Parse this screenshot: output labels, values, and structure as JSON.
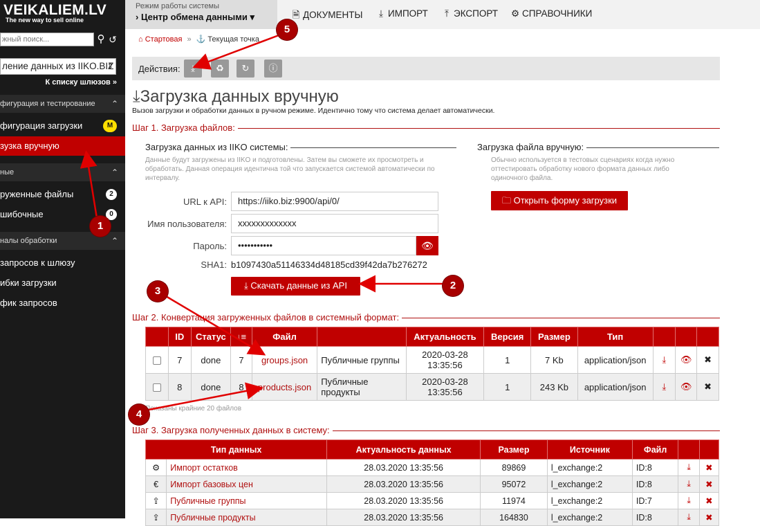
{
  "sidebar": {
    "logo": "VEIKALIEM.LV",
    "logo_sub": "The new way to sell online",
    "search_placeholder": "жный поиск...",
    "gateway_select": "ление данных из IIKO.BIZ",
    "gateway_link": "К списку шлюзов »",
    "sections": [
      {
        "label": "фигурация и тестирование"
      },
      {
        "label": "ные"
      },
      {
        "label": "налы обработки"
      }
    ],
    "items": [
      {
        "label": "фигурация загрузки",
        "badge": "M"
      },
      {
        "label": "зузка вручную",
        "badge": ""
      },
      {
        "label": "руженные файлы",
        "badge": "2"
      },
      {
        "label": "шибочные",
        "badge": "0"
      },
      {
        "label": "запросов к шлюзу",
        "badge": ""
      },
      {
        "label": "ибки загрузки",
        "badge": ""
      },
      {
        "label": "фик запросов",
        "badge": ""
      }
    ]
  },
  "topbar": {
    "mode_label": "Режим работы системы",
    "mode_value": "› Центр обмена данными ▾",
    "nav": [
      "ДОКУМЕНТЫ",
      "ИМПОРТ",
      "ЭКСПОРТ",
      "СПРАВОЧНИКИ"
    ]
  },
  "breadcrumb": {
    "home": "Стартовая",
    "sep": "»",
    "current": "Текущая точка"
  },
  "actions": {
    "label": "Действия:"
  },
  "page": {
    "title": "Загрузка данных вручную",
    "subtitle": "Вызов загрузки и обработки данных в ручном режиме. Идентично тому что система делает автоматически."
  },
  "step1": {
    "title": "Шаг 1. Загрузка файлов:",
    "iiko_title": "Загрузка данных из IIKO системы:",
    "iiko_help": "Данные будут загружены из IIKO и подготовлены. Затем вы сможете их просмотреть и обработать. Данная операция идентична той что запускается системой автоматически по интервалу.",
    "manual_title": "Загрузка файла вручную:",
    "manual_help": "Обычно используется в тестовых сценариях когда нужно оттестировать обработку нового формата данных либо одиночного файла.",
    "open_form_button": "Открыть форму загрузки",
    "url_label": "URL к API:",
    "url_value": "https://iiko.biz:9900/api/0/",
    "user_label": "Имя пользователя:",
    "user_value": "xxxxxxxxxxxxx",
    "pass_label": "Пароль:",
    "pass_value": "•••••••••••",
    "sha_label": "SHA1:",
    "sha_value": "b1097430a51146334d48185cd39f42da7b276272",
    "download_button": "Скачать данные из API"
  },
  "step2": {
    "title": "Шаг 2. Конвертация загруженных файлов в системный формат:",
    "headers": [
      "",
      "ID",
      "Статус",
      "↓≡",
      "Файл",
      "",
      "Актуальность",
      "Версия",
      "Размер",
      "Тип",
      "",
      "",
      ""
    ],
    "rows": [
      {
        "id": "7",
        "status": "done",
        "count": "7",
        "file": "groups.json",
        "desc": "Публичные группы",
        "actual": "2020-03-28 13:35:56",
        "version": "1",
        "size": "7 Kb",
        "type": "application/json"
      },
      {
        "id": "8",
        "status": "done",
        "count": "8",
        "file": "products.json",
        "desc": "Публичные продукты",
        "actual": "2020-03-28 13:35:56",
        "version": "1",
        "size": "243 Kb",
        "type": "application/json"
      }
    ],
    "note": "Показаны крайние 20 файлов"
  },
  "step3": {
    "title": "Шаг 3. Загрузка полученных данных в систему:",
    "headers": [
      "Тип данных",
      "Актуальность данных",
      "Размер",
      "Источник",
      "Файл"
    ],
    "rows": [
      {
        "icon": "⚙",
        "type": "Импорт остатков",
        "actual": "28.03.2020 13:35:56",
        "size": "89869",
        "source": "l_exchange:2",
        "file": "ID:8"
      },
      {
        "icon": "€",
        "type": "Импорт базовых цен",
        "actual": "28.03.2020 13:35:56",
        "size": "95072",
        "source": "l_exchange:2",
        "file": "ID:8"
      },
      {
        "icon": "⇪",
        "type": "Публичные группы",
        "actual": "28.03.2020 13:35:56",
        "size": "11974",
        "source": "l_exchange:2",
        "file": "ID:7"
      },
      {
        "icon": "⇪",
        "type": "Публичные продукты",
        "actual": "28.03.2020 13:35:56",
        "size": "164830",
        "source": "l_exchange:2",
        "file": "ID:8"
      }
    ]
  },
  "callouts": [
    "1",
    "2",
    "3",
    "4",
    "5"
  ],
  "colors": {
    "brand_red": "#c00000",
    "sidebar_bg": "#1a1a1a",
    "callout": "#a80000"
  }
}
